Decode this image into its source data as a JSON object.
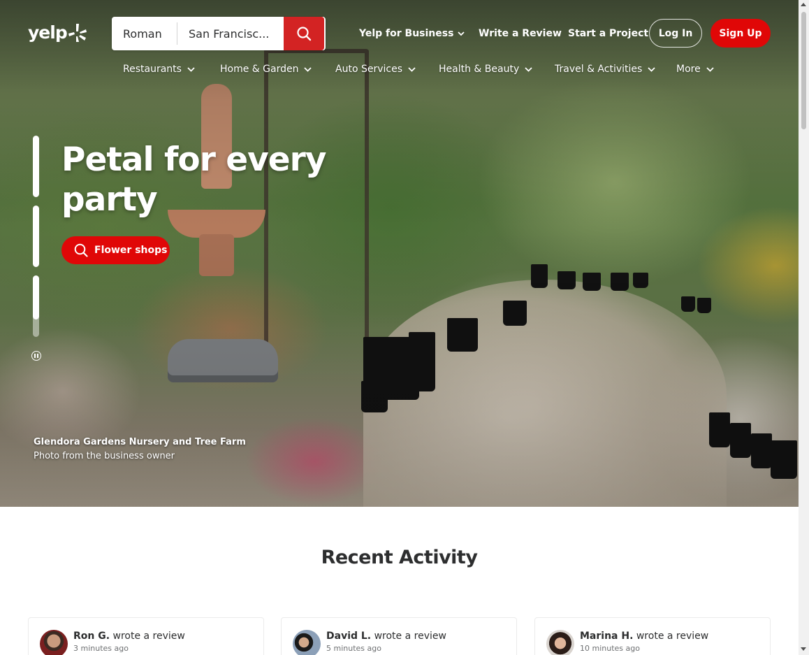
{
  "header": {
    "logo_text": "yelp",
    "search": {
      "find_value": "Roman",
      "near_value": "San Francisc..."
    },
    "top_links": [
      {
        "label": "Yelp for Business",
        "has_dropdown": true
      },
      {
        "label": "Write a Review"
      },
      {
        "label": "Start a Project"
      }
    ],
    "login_label": "Log In",
    "signup_label": "Sign Up"
  },
  "categories": [
    {
      "label": "Restaurants"
    },
    {
      "label": "Home & Garden"
    },
    {
      "label": "Auto Services"
    },
    {
      "label": "Health & Beauty"
    },
    {
      "label": "Travel & Activities"
    },
    {
      "label": "More"
    }
  ],
  "hero": {
    "headline": "Petal for every party",
    "cta_label": "Flower shops",
    "business_name": "Glendora Gardens Nursery and Tree Farm",
    "photo_credit": "Photo from the business owner",
    "slides_progress": [
      1.0,
      1.0,
      0.72
    ]
  },
  "recent_activity": {
    "title": "Recent Activity",
    "cards": [
      {
        "user": "Ron G.",
        "action": "wrote a review",
        "time": "3 minutes ago"
      },
      {
        "user": "David L.",
        "action": "wrote a review",
        "time": "5 minutes ago"
      },
      {
        "user": "Marina H.",
        "action": "wrote a review",
        "time": "10 minutes ago"
      }
    ]
  },
  "colors": {
    "brand_red": "#d32323",
    "button_red": "#e00707",
    "text_dark": "#2d2e2f",
    "text_muted": "#6e7072"
  },
  "icons": {
    "logo": "yelp-burst-icon",
    "search": "search-icon",
    "dropdown": "chevron-down-icon",
    "pause": "pause-icon"
  }
}
